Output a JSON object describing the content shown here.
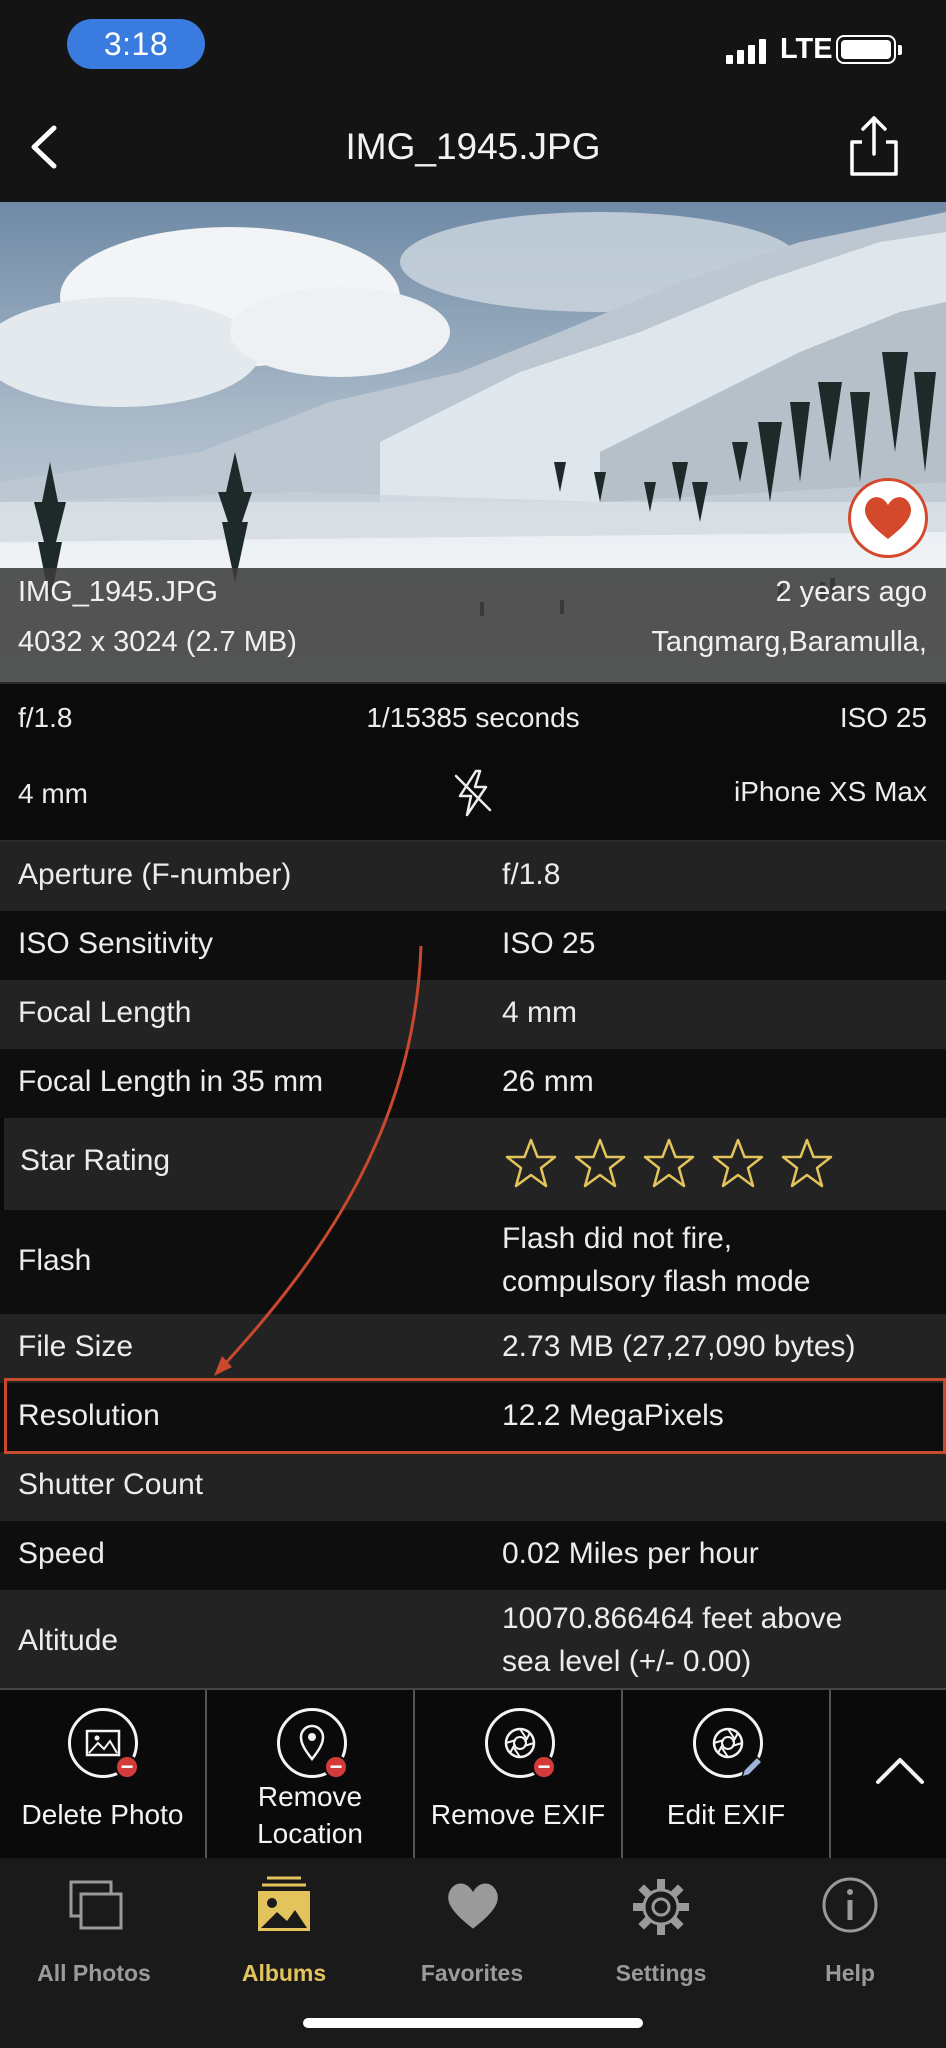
{
  "status_bar": {
    "time": "3:18",
    "network": "LTE",
    "signal_bars": 4,
    "battery_level": 1.0
  },
  "nav": {
    "title": "IMG_1945.JPG"
  },
  "photo": {
    "favorite": true
  },
  "info": {
    "filename": "IMG_1945.JPG",
    "age": "2 years ago",
    "dimensions": "4032 x 3024 (2.7 MB)",
    "location": "Tangmarg,Baramulla,"
  },
  "summary": {
    "aperture": "f/1.8",
    "shutter": "1/15385 seconds",
    "iso": "ISO 25",
    "focal": "4 mm",
    "flash_icon": "flash-off-icon",
    "device": "iPhone XS Max"
  },
  "details": [
    {
      "label": "Aperture (F-number)",
      "value": "f/1.8"
    },
    {
      "label": "ISO Sensitivity",
      "value": "ISO 25"
    },
    {
      "label": "Focal Length",
      "value": "4 mm"
    },
    {
      "label": "Focal Length in 35 mm",
      "value": "26 mm"
    },
    {
      "label": "Star Rating",
      "value": "",
      "rating": 0,
      "max_rating": 5
    },
    {
      "label": "Flash",
      "value": "Flash did not fire,",
      "value_line2": "compulsory flash mode"
    },
    {
      "label": "File Size",
      "value": "2.73 MB (27,27,090 bytes)"
    },
    {
      "label": "Resolution",
      "value": "12.2 MegaPixels"
    },
    {
      "label": "Shutter Count",
      "value": ""
    },
    {
      "label": "Speed",
      "value": "0.02 Miles per hour"
    },
    {
      "label": "Altitude",
      "value": "10070.866464 feet above",
      "value_line2": "sea level (+/- 0.00)"
    }
  ],
  "actions": [
    {
      "label": "Delete Photo",
      "icon": "photo-delete-icon"
    },
    {
      "label": "Remove",
      "label_line2": "Location",
      "icon": "location-remove-icon"
    },
    {
      "label": "Remove EXIF",
      "icon": "aperture-remove-icon"
    },
    {
      "label": "Edit EXIF",
      "icon": "aperture-edit-icon"
    }
  ],
  "tabs": [
    {
      "label": "All Photos",
      "icon": "photos-stack-icon",
      "active": false
    },
    {
      "label": "Albums",
      "icon": "album-icon",
      "active": true
    },
    {
      "label": "Favorites",
      "icon": "heart-icon",
      "active": false
    },
    {
      "label": "Settings",
      "icon": "gear-icon",
      "active": false
    },
    {
      "label": "Help",
      "icon": "info-icon",
      "active": false
    }
  ],
  "colors": {
    "accent_gold": "#e3c45c",
    "highlight_red": "#c9492e",
    "time_pill": "#3a7be0",
    "badge_red": "#d33a3a"
  }
}
